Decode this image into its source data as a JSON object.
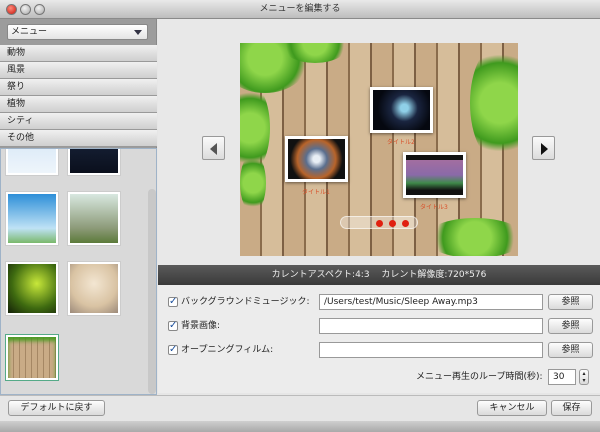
{
  "window": {
    "title": "メニューを編集する"
  },
  "sidebar": {
    "dropdown": {
      "value": "メニュー"
    },
    "categories": [
      "動物",
      "風景",
      "祭り",
      "植物",
      "シティ",
      "その他"
    ],
    "default_button": "デフォルトに戻す"
  },
  "preview": {
    "titles": [
      "タイトル1",
      "タイトル2",
      "タイトル3"
    ]
  },
  "status": {
    "text": "カレントアスペクト:4:3　 カレント解像度:720*576"
  },
  "form": {
    "bgm": {
      "checked": true,
      "label": "バックグラウンドミュージック:",
      "value": "/Users/test/Music/Sleep Away.mp3",
      "browse": "参照"
    },
    "bg_image": {
      "checked": true,
      "label": "背景画像:",
      "value": "",
      "browse": "参照"
    },
    "opening": {
      "checked": true,
      "label": "オープニングフィルム:",
      "value": "",
      "browse": "参照"
    },
    "loop": {
      "label": "メニュー再生のループ時間(秒):",
      "value": "30"
    }
  },
  "footer": {
    "cancel": "キャンセル",
    "save": "保存"
  },
  "colors": {
    "status_bar": "#444444",
    "checkbox_mark": "#1a4f9c",
    "title_text": "#d9502a"
  }
}
